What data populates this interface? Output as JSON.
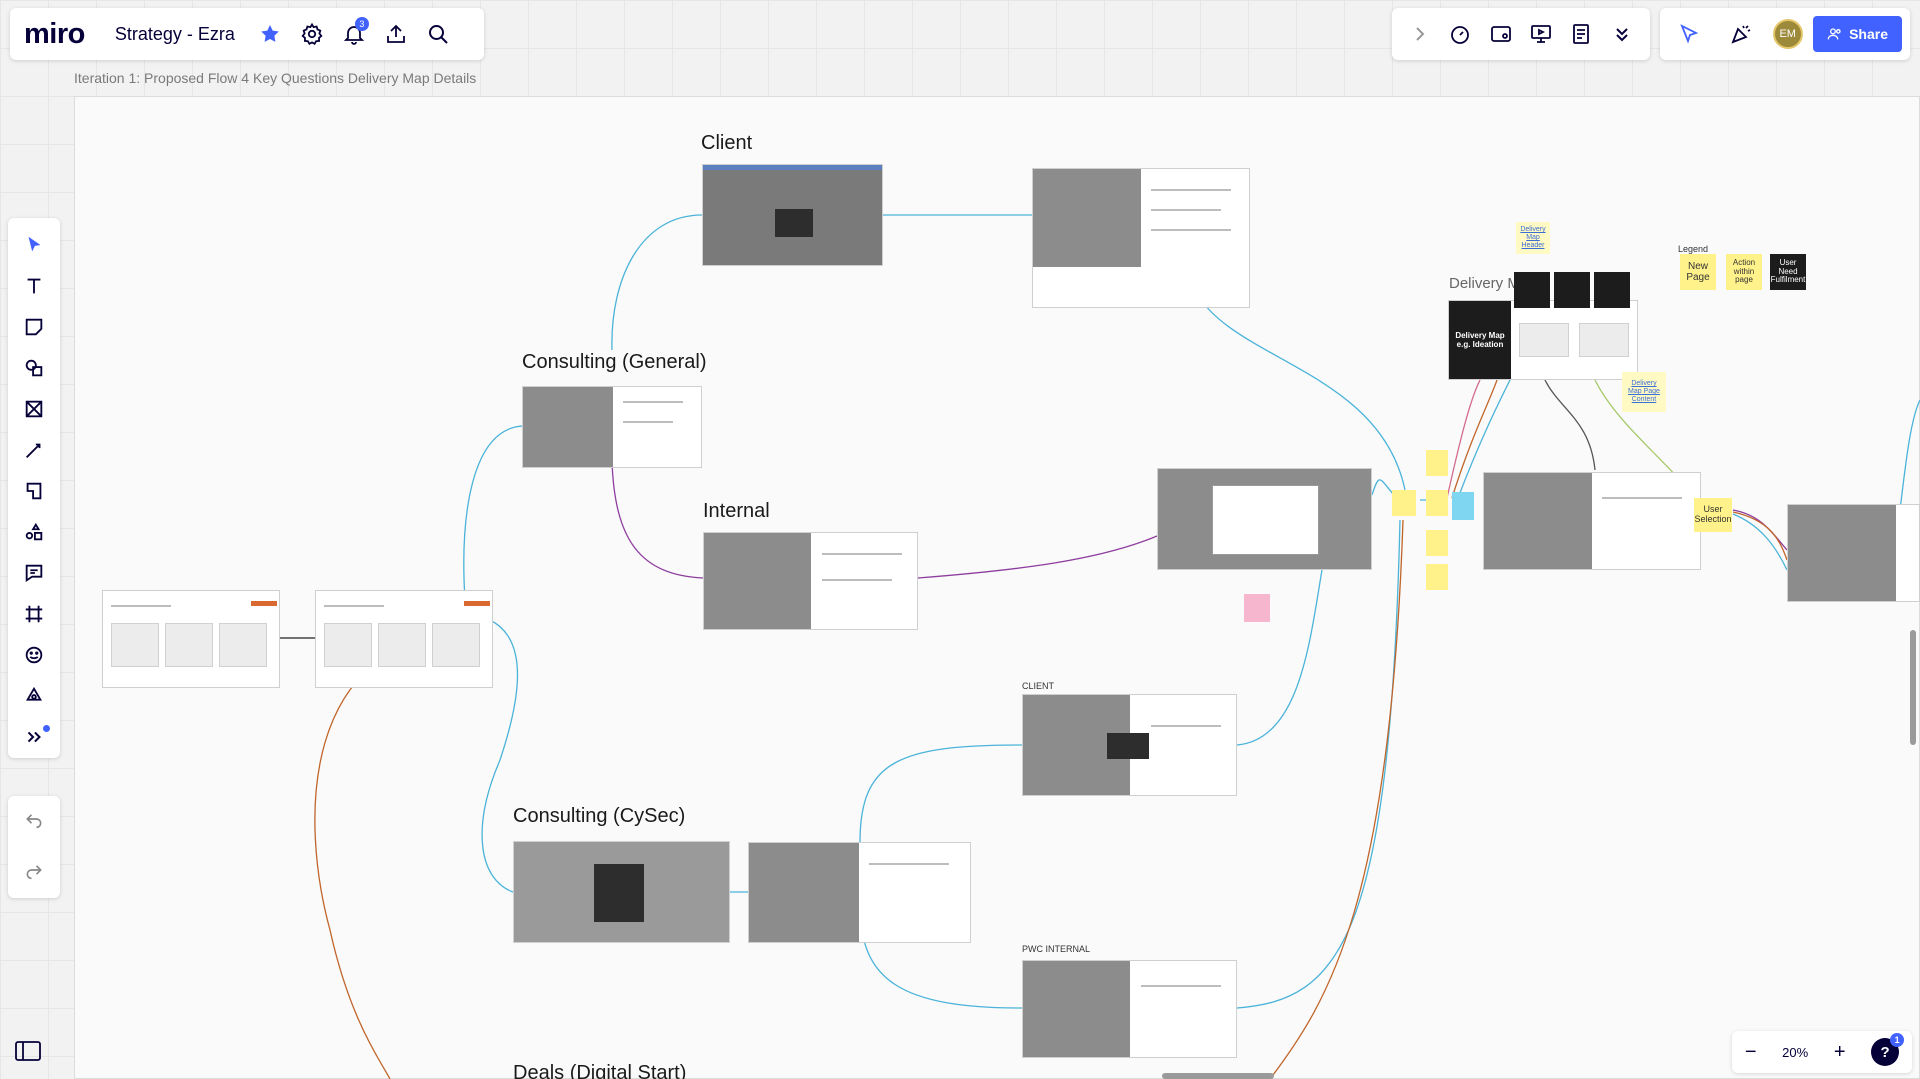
{
  "app": {
    "logo": "miro",
    "board_name": "Strategy - Ezra",
    "notification_count": "3",
    "share_label": "Share",
    "avatar_initials": "EM",
    "zoom_level": "20%",
    "help_badge": "1"
  },
  "frame": {
    "label": "Iteration 1: Proposed Flow 4 Key Questions Delivery Map Details"
  },
  "sections": {
    "client": "Client",
    "consulting_general": "Consulting (General)",
    "internal": "Internal",
    "consulting_cysec": "Consulting (CySec)",
    "deals_digital_start": "Deals (Digital Start)",
    "client_small": "CLIENT",
    "pwc_internal": "PWC INTERNAL",
    "delivery_partial": "Delivery M"
  },
  "stickies": {
    "delivery_map_ideation": "Delivery Map e.g. Ideation",
    "delivery_map_header": "Delivery Map Header",
    "delivery_map_page_content": "Delivery Map Page Content",
    "user_selection": "User Selection",
    "legend_title": "Legend",
    "legend_new_page": "New Page",
    "legend_action_within_page": "Action within page",
    "legend_user_need": "User Need Fulfilment"
  },
  "icons": {
    "star": "star-icon",
    "settings": "gear-icon",
    "notifications": "bell-icon",
    "upload": "upload-icon",
    "search": "search-icon"
  },
  "colors": {
    "accent": "#4262ff",
    "connector_blue": "#4ab3d9",
    "connector_purple": "#8e3c9e",
    "connector_orange": "#c0652a",
    "sticky_yellow": "#fff28a"
  }
}
